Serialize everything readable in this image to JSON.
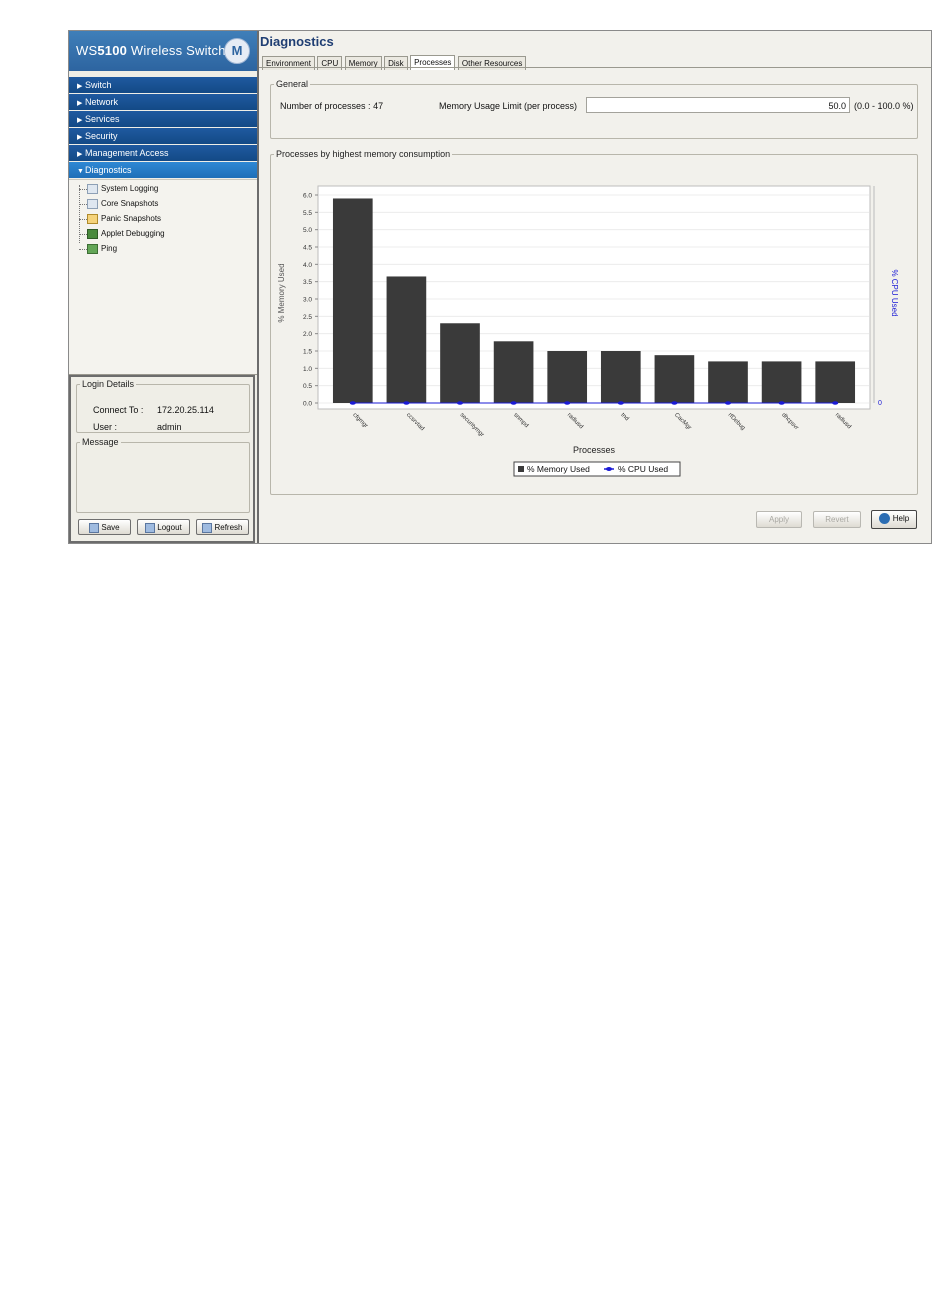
{
  "app": {
    "brand_prefix": "WS",
    "brand_bold": "5100",
    "brand_suffix": "Wireless Switch",
    "logo_glyph": "M"
  },
  "nav": [
    {
      "label": "Switch",
      "expanded": false
    },
    {
      "label": "Network",
      "expanded": false
    },
    {
      "label": "Services",
      "expanded": false
    },
    {
      "label": "Security",
      "expanded": false
    },
    {
      "label": "Management Access",
      "expanded": false
    },
    {
      "label": "Diagnostics",
      "expanded": true
    }
  ],
  "tree": [
    {
      "label": "System Logging",
      "icon": "log-icon"
    },
    {
      "label": "Core Snapshots",
      "icon": "snapshot-icon"
    },
    {
      "label": "Panic Snapshots",
      "icon": "panic-icon"
    },
    {
      "label": "Applet Debugging",
      "icon": "debug-icon"
    },
    {
      "label": "Ping",
      "icon": "ping-icon"
    }
  ],
  "login": {
    "title": "Login Details",
    "connect_label": "Connect To :",
    "connect_value": "172.20.25.114",
    "user_label": "User :",
    "user_value": "admin",
    "message_title": "Message",
    "save": "Save",
    "logout": "Logout",
    "refresh": "Refresh"
  },
  "page": {
    "title": "Diagnostics",
    "tabs": [
      "Environment",
      "CPU",
      "Memory",
      "Disk",
      "Processes",
      "Other Resources"
    ],
    "selected_tab": "Processes",
    "general_title": "General",
    "num_processes_label": "Number of processes :",
    "num_processes_value": "47",
    "mem_limit_label": "Memory Usage Limit (per process)",
    "mem_limit_value": "50.0",
    "mem_limit_range": "(0.0 - 100.0 %)",
    "chart_section_title": "Processes by highest memory consumption",
    "apply": "Apply",
    "revert": "Revert",
    "help": "Help"
  },
  "colors": {
    "bar": "#3a3a3a",
    "cpu_marker": "#1a1ad6",
    "nav_bg": "#1a529a",
    "accent": "#2d64a0"
  },
  "chart_data": {
    "type": "bar",
    "categories": [
      "cfgmgr",
      "ccsrvtad",
      "securitymgr",
      "snmpd",
      "radiusd",
      "tnd",
      "CacMgr",
      "rfDebug",
      "dhcpsvr",
      "radiusd"
    ],
    "series": [
      {
        "name": "% Memory Used",
        "axis": "left",
        "values": [
          5.9,
          3.65,
          2.3,
          1.78,
          1.5,
          1.5,
          1.38,
          1.2,
          1.2,
          1.2
        ]
      },
      {
        "name": "% CPU Used",
        "axis": "right",
        "values": [
          0,
          0,
          0,
          0,
          0,
          0,
          0,
          0,
          0,
          0
        ]
      }
    ],
    "xlabel": "Processes",
    "ylabel": "% Memory Used",
    "y2label": "% CPU Used",
    "ylim": [
      0,
      6.0
    ],
    "yticks": [
      "0.0",
      "0.5",
      "1.0",
      "1.5",
      "2.0",
      "2.5",
      "3.0",
      "3.5",
      "4.0",
      "4.5",
      "5.0",
      "5.5",
      "6.0"
    ],
    "y2ticks": [
      "0"
    ],
    "legend": "bottom",
    "grid": true
  }
}
